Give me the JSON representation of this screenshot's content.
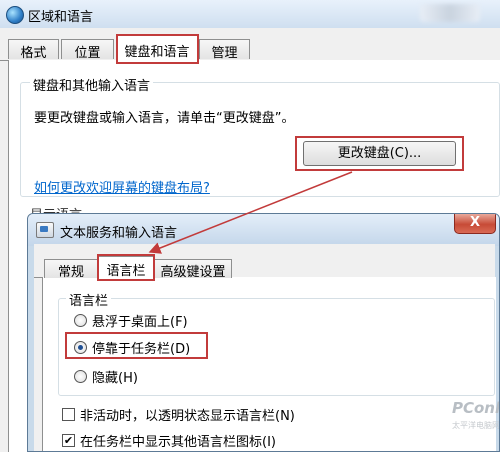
{
  "outer": {
    "title": "区域和语言",
    "tabs": [
      "格式",
      "位置",
      "键盘和语言",
      "管理"
    ],
    "active_tab": "键盘和语言",
    "keyboard_group": {
      "label": "键盘和其他输入语言",
      "description": "要更改键盘或输入语言，请单击“更改键盘”。",
      "change_button": "更改键盘(C)...",
      "welcome_link": "如何更改欢迎屏幕的键盘布局?"
    },
    "display_language_label": "显示语言"
  },
  "inner": {
    "title": "文本服务和输入语言",
    "close_glyph": "X",
    "tabs": [
      "常规",
      "语言栏",
      "高级键设置"
    ],
    "active_tab": "语言栏",
    "language_bar_group": {
      "label": "语言栏",
      "options": [
        {
          "label": "悬浮于桌面上(F)",
          "checked": false
        },
        {
          "label": "停靠于任务栏(D)",
          "checked": true
        },
        {
          "label": "隐藏(H)",
          "checked": false
        }
      ]
    },
    "checkboxes": [
      {
        "label": "非活动时，以透明状态显示语言栏(N)",
        "checked": false
      },
      {
        "label": "在任务栏中显示其他语言栏图标(I)",
        "checked": true
      }
    ]
  },
  "watermark": {
    "brand": "PConline",
    "sub": "太平洋电脑网"
  },
  "colors": {
    "highlight_border": "#c23b3b",
    "link": "#0066cc",
    "close_button": "#c74b36"
  }
}
